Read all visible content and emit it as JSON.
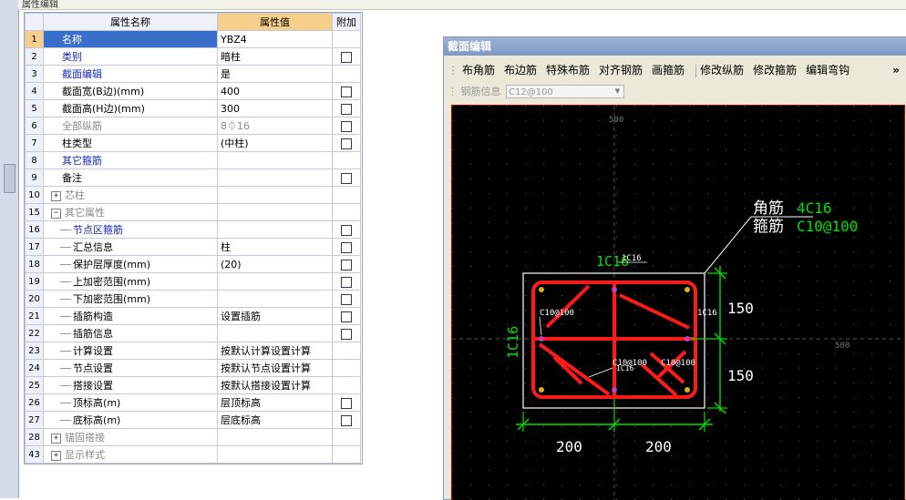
{
  "window_tab": "属性编辑",
  "grid": {
    "headers": {
      "name": "属性名称",
      "value": "属性值",
      "add": "附加"
    },
    "rows": [
      {
        "num": "1",
        "name": "名称",
        "value": "YBZ4",
        "check": false,
        "style": "selected"
      },
      {
        "num": "2",
        "name": "类别",
        "value": "暗柱",
        "check": true,
        "style": "blue"
      },
      {
        "num": "3",
        "name": "截面编辑",
        "value": "是",
        "check": false,
        "style": "blue"
      },
      {
        "num": "4",
        "name": "截面宽(B边)(mm)",
        "value": "400",
        "check": true,
        "style": "normal"
      },
      {
        "num": "5",
        "name": "截面高(H边)(mm)",
        "value": "300",
        "check": true,
        "style": "normal"
      },
      {
        "num": "6",
        "name": "全部纵筋",
        "value": "8⏀16",
        "check": true,
        "style": "gray"
      },
      {
        "num": "7",
        "name": "柱类型",
        "value": "(中柱)",
        "check": true,
        "style": "normal"
      },
      {
        "num": "8",
        "name": "其它箍筋",
        "value": "",
        "check": false,
        "style": "blue"
      },
      {
        "num": "9",
        "name": "备注",
        "value": "",
        "check": true,
        "style": "normal"
      },
      {
        "num": "10",
        "name": "芯柱",
        "value": "",
        "check": false,
        "style": "group-collapsed"
      },
      {
        "num": "15",
        "name": "其它属性",
        "value": "",
        "check": false,
        "style": "group-expanded"
      },
      {
        "num": "16",
        "name": "节点区箍筋",
        "value": "",
        "check": true,
        "style": "child-blue"
      },
      {
        "num": "17",
        "name": "汇总信息",
        "value": "柱",
        "check": true,
        "style": "child"
      },
      {
        "num": "18",
        "name": "保护层厚度(mm)",
        "value": "(20)",
        "check": true,
        "style": "child"
      },
      {
        "num": "19",
        "name": "上加密范围(mm)",
        "value": "",
        "check": true,
        "style": "child"
      },
      {
        "num": "20",
        "name": "下加密范围(mm)",
        "value": "",
        "check": true,
        "style": "child"
      },
      {
        "num": "21",
        "name": "插筋构造",
        "value": "设置插筋",
        "check": true,
        "style": "child"
      },
      {
        "num": "22",
        "name": "插筋信息",
        "value": "",
        "check": true,
        "style": "child"
      },
      {
        "num": "23",
        "name": "计算设置",
        "value": "按默认计算设置计算",
        "check": false,
        "style": "child"
      },
      {
        "num": "24",
        "name": "节点设置",
        "value": "按默认节点设置计算",
        "check": false,
        "style": "child"
      },
      {
        "num": "25",
        "name": "搭接设置",
        "value": "按默认搭接设置计算",
        "check": false,
        "style": "child"
      },
      {
        "num": "26",
        "name": "顶标高(m)",
        "value": "层顶标高",
        "check": true,
        "style": "child"
      },
      {
        "num": "27",
        "name": "底标高(m)",
        "value": "层底标高",
        "check": true,
        "style": "child"
      },
      {
        "num": "28",
        "name": "锚固搭接",
        "value": "",
        "check": false,
        "style": "group-collapsed-gray"
      },
      {
        "num": "43",
        "name": "显示样式",
        "value": "",
        "check": false,
        "style": "group-collapsed-gray"
      }
    ]
  },
  "panel": {
    "title": "截面编辑",
    "toolbar": [
      "布角筋",
      "布边筋",
      "特殊布筋",
      "对齐钢筋",
      "画箍筋",
      "修改纵筋",
      "修改箍筋",
      "编辑弯钩"
    ],
    "more": "»",
    "rebar_info_label": "钢筋信息",
    "rebar_info_value": "C12@100",
    "drawing": {
      "axis_label_top": "500",
      "axis_label_right": "500",
      "corner_label": "角筋",
      "corner_value": "4C16",
      "stirrup_label": "箍筋",
      "stirrup_value": "C10@100",
      "top_edge_green": "1C16",
      "top_edge_white": "1C16",
      "left_edge": "1C16",
      "right_edge_tag": "1C16",
      "inner_tag_left": "C10@100",
      "inner_tag_mid": "C10@100",
      "inner_tag_mid2": "1C16",
      "inner_tag_right": "C10@100",
      "dim_right_top": "150",
      "dim_right_bottom": "150",
      "dim_bottom_left": "200",
      "dim_bottom_right": "200"
    }
  },
  "colors": {
    "rebar": "#ff1a1a",
    "dimension": "#00e000",
    "selection": "#3a6fc9",
    "header_highlight": "#f8cf8a"
  }
}
